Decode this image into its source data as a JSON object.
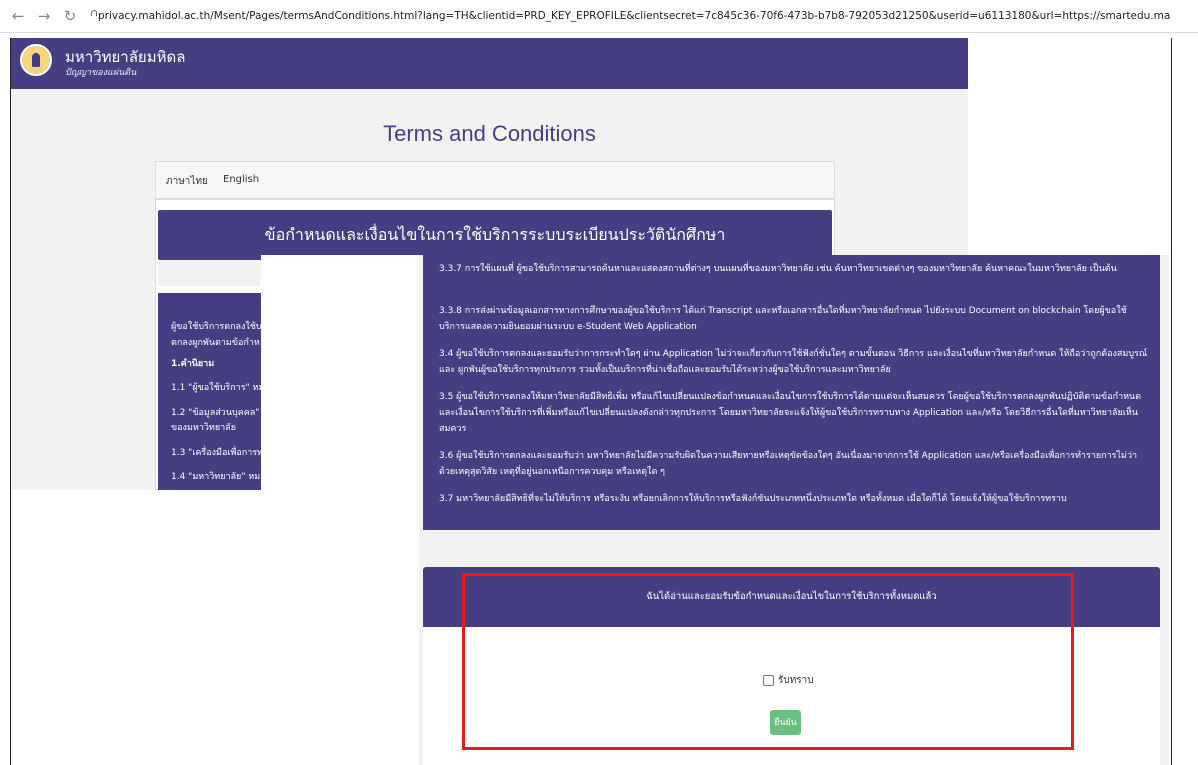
{
  "browser": {
    "back_icon": "back-arrow-icon",
    "forward_icon": "forward-arrow-icon",
    "reload_icon": "reload-icon",
    "url": "privacy.mahidol.ac.th/Msent/Pages/termsAndConditions.html?lang=TH&clientid=PRD_KEY_EPROFILE&clientsecret=7c845c36-70f6-473b-b7b8-792053d21250&userid=u6113180&url=https://smartedu.mahidol.ac.th/..."
  },
  "header": {
    "university_name": "มหาวิทยาลัยมหิดล",
    "university_subtitle": "ปัญญาของแผ่นดิน"
  },
  "page": {
    "title": "Terms and Conditions",
    "lang_tabs": [
      "ภาษาไทย",
      "English"
    ],
    "doc_title": "ข้อกำหนดและเงื่อนไขในการใช้บริการระบบระเบียนประวัตินักศึกษา"
  },
  "toc": {
    "intro_1": "ผู้ขอใช้บริการตกลงใช้บ",
    "intro_2": "ตกลงผูกพันตามข้อกำห",
    "definitions_heading": "1.คำนิยาม",
    "item_1_1": "1.1 \"ผู้ขอใช้บริการ\" หมาย",
    "item_1_2a": "1.2 \"ข้อมูลส่วนบุคคล\" ห",
    "item_1_2b": "ของมหาวิทยาลัย",
    "item_1_3": "1.3 \"เครื่องมือเพื่อการท",
    "item_1_4": "1.4 \"มหาวิทยาลัย\" หมาย"
  },
  "terms": {
    "t_3_3_7": "3.3.7 การใช้แผนที่ ผู้ขอใช้บริการสามารถค้นหาและแสดงสถานที่ต่างๆ บนแผนที่ของมหาวิทยาลัย เช่น ค้นหาวิทยาเขตต่างๆ ของมหาวิทยาลัย ค้นหาคณะในมหาวิทยาลัย เป็นต้น",
    "t_3_3_8": "3.3.8 การส่งผ่านข้อมูลเอกสารทางการศึกษาของผู้ขอใช้บริการ ได้แก่ Transcript และหรือเอกสารอื่นใดที่มหาวิทยาลัยกำหนด ไปยังระบบ Document on blockchain โดยผู้ขอใช้บริการแสดงความยินยอมผ่านระบบ e-Student Web Application",
    "t_3_4": "3.4 ผู้ขอใช้บริการตกลงและยอมรับว่าการกระทำใดๆ ผ่าน Application ไม่ว่าจะเกี่ยวกับการใช้ฟังก์ชั่นใดๆ ตามขั้นตอน วิธีการ และเงื่อนไขที่มหาวิทยาลัยกำหนด ให้ถือว่าถูกต้องสมบูรณ์และ ผูกพันผู้ขอใช้บริการทุกประการ รวมทั้งเป็นบริการที่น่าเชื่อถือและยอมรับได้ระหว่างผู้ขอใช้บริการและมหาวิทยาลัย",
    "t_3_5": "3.5 ผู้ขอใช้บริการตกลงให้มหาวิทยาลัยมีสิทธิเพิ่ม หรือแก้ไขเปลี่ยนแปลงข้อกำหนดและเงื่อนไขการใช้บริการได้ตามแต่จะเห็นสมควร โดยผู้ขอใช้บริการตกลงผูกพันปฏิบัติตามข้อกำหนดและเงื่อนไขการใช้บริการที่เพิ่มหรือแก้ไขเปลี่ยนแปลงดังกล่าวทุกประการ โดยมหาวิทยาลัยจะแจ้งให้ผู้ขอใช้บริการทราบทาง Application และ/หรือ โดยวิธีการอื่นใดที่มหาวิทยาลัยเห็นสมควร",
    "t_3_6": "3.6 ผู้ขอใช้บริการตกลงและยอมรับว่า มหาวิทยาลัยไม่มีความรับผิดในความเสียหายหรือเหตุขัดข้องใดๆ อันเนื่องมาจากการใช้ Application และ/หรือเครื่องมือเพื่อการทำรายการไม่ว่าด้วยเหตุสุดวิสัย เหตุที่อยู่นอกเหนือการควบคุม หรือเหตุใด ๆ",
    "t_3_7": "3.7 มหาวิทยาลัยมีสิทธิที่จะไม่ให้บริการ หรือระงับ หรือยกเลิกการให้บริการหรือฟังก์ชันประเภทหนึ่งประเภทใด หรือทั้งหมด เมื่อใดก็ได้ โดยแจ้งให้ผู้ขอใช้บริการทราบ"
  },
  "acceptance": {
    "header": "ฉันได้อ่านและยอมรับข้อกำหนดและเงื่อนไขในการใช้บริการทั้งหมดแล้ว",
    "checkbox_label": "รับทราบ",
    "checkbox_checked": false,
    "confirm_label": "ยืนยัน"
  },
  "colors": {
    "brand": "#463e83",
    "confirm_button": "#6cbf7f",
    "highlight": "#e81a1a"
  }
}
